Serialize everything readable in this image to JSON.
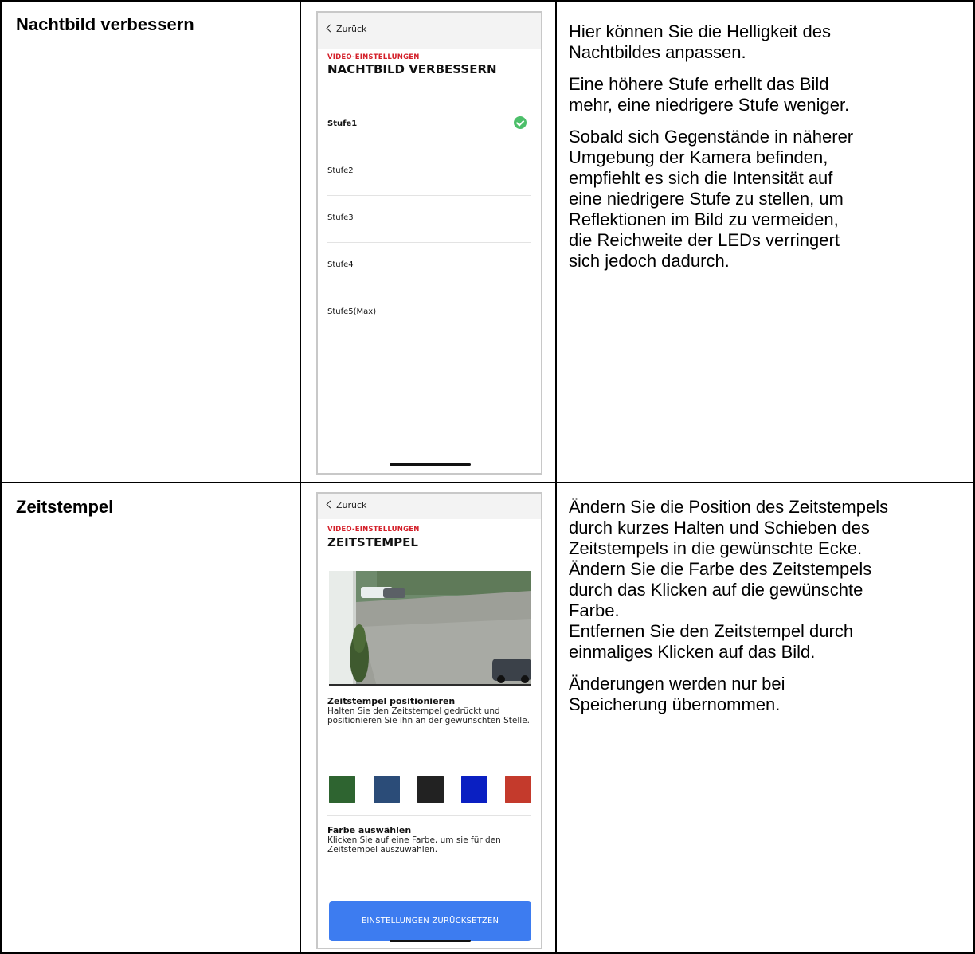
{
  "rows": [
    {
      "title": "Nachtbild verbessern",
      "paragraphs": [
        "Hier können Sie die Helligkeit des\nNachtbildes anpassen.",
        "Eine höhere Stufe erhellt das Bild\nmehr, eine niedrigere Stufe weniger.",
        "Sobald sich Gegenstände in näherer\nUmgebung der Kamera befinden,\nempfiehlt es sich die Intensität auf\neine niedrigere Stufe zu stellen, um\nReflektionen im Bild zu vermeiden,\ndie Reichweite der LEDs verringert\nsich jedoch dadurch."
      ],
      "phone": {
        "back_label": "Zurück",
        "kicker": "VIDEO-EINSTELLUNGEN",
        "title": "NACHTBILD VERBESSERN",
        "options": [
          "Stufe1",
          "Stufe2",
          "Stufe3",
          "Stufe4",
          "Stufe5(Max)"
        ],
        "selected": "Stufe1"
      }
    },
    {
      "title": "Zeitstempel",
      "paragraphs": [
        "Ändern Sie die Position des Zeitstempels\ndurch kurzes Halten und Schieben des\nZeitstempels in die gewünschte Ecke.\nÄndern Sie die Farbe des Zeitstempels\ndurch das Klicken auf die gewünschte\nFarbe.\nEntfernen Sie den Zeitstempel durch\neinmaliges Klicken auf das Bild.",
        "Änderungen werden nur bei\nSpeicherung übernommen."
      ],
      "phone": {
        "back_label": "Zurück",
        "kicker": "VIDEO-EINSTELLUNGEN",
        "title": "ZEITSTEMPEL",
        "position_heading": "Zeitstempel positionieren",
        "position_text": "Halten Sie den Zeitstempel gedrückt und positionieren Sie ihn an der gewünschten Stelle.",
        "swatch_colors": [
          "#2e6430",
          "#2b4c78",
          "#222222",
          "#0a1fc2",
          "#c43a2c"
        ],
        "color_heading": "Farbe auswählen",
        "color_text": "Klicken Sie auf eine Farbe, um sie für den Zeitstempel auszuwählen.",
        "reset_button": "EINSTELLUNGEN ZURÜCKSETZEN"
      }
    }
  ]
}
